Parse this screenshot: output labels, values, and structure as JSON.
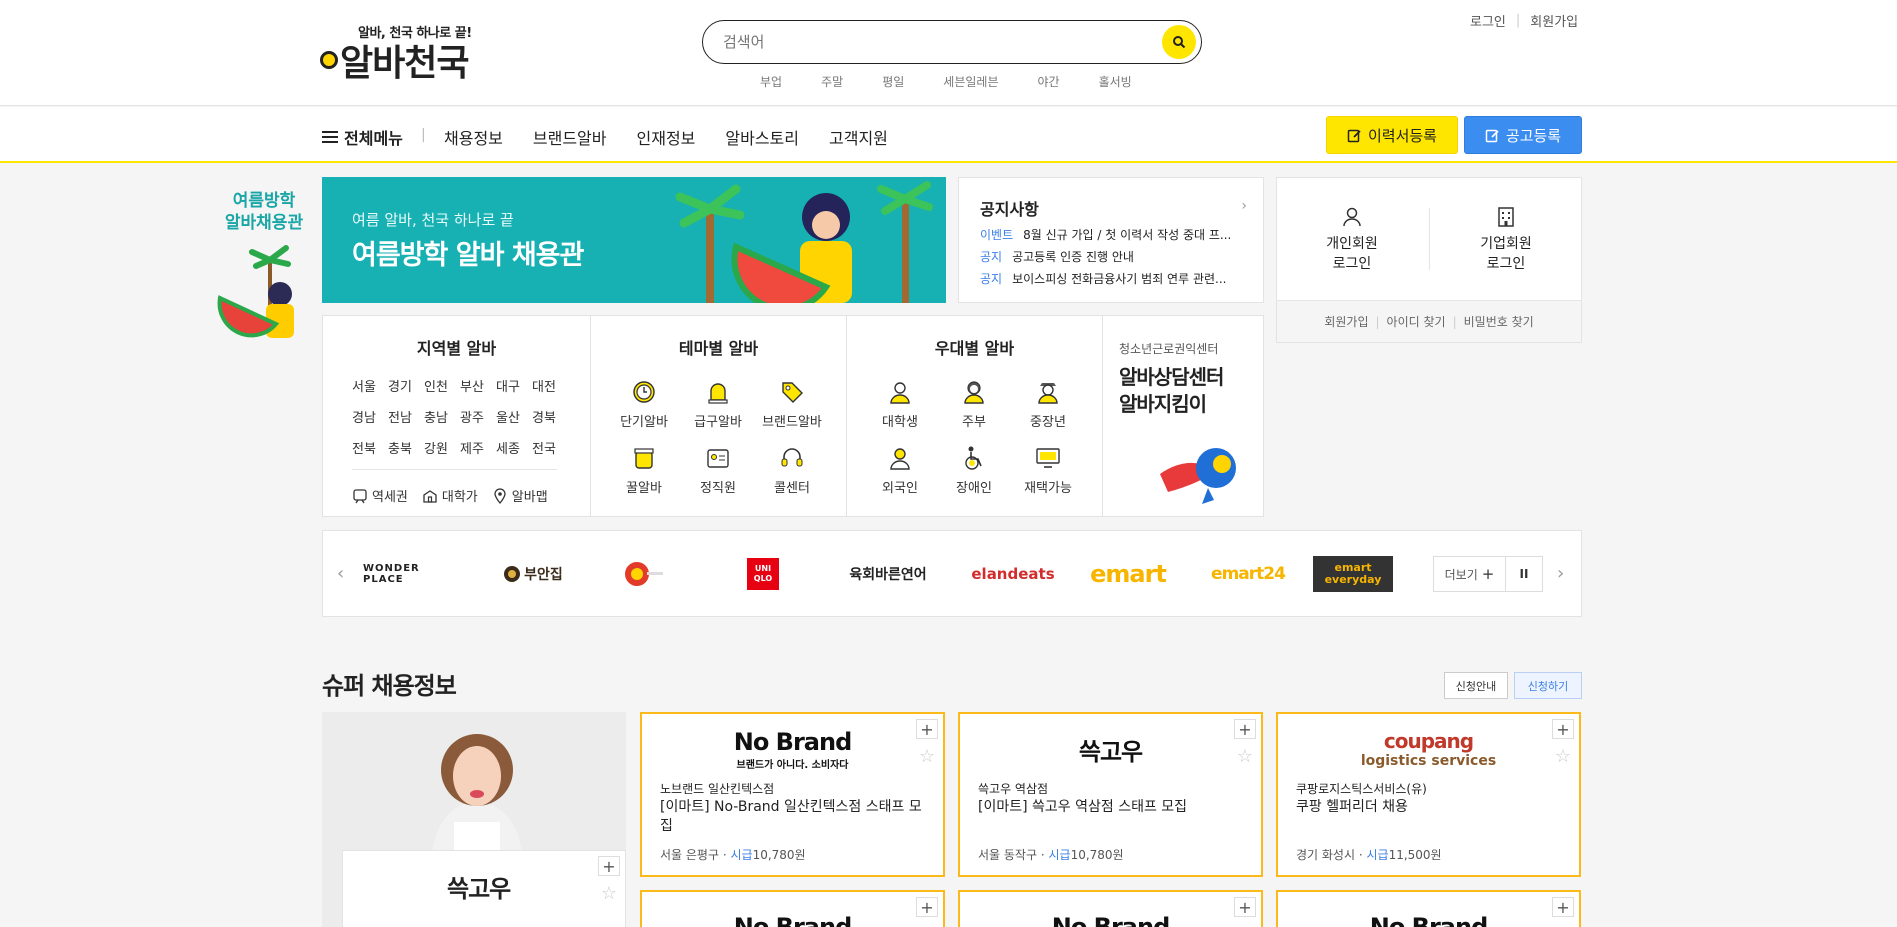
{
  "header": {
    "slogan": "알바, 천국 하나로 끝!",
    "logo_text": "알바천국",
    "search_placeholder": "검색어",
    "keywords": [
      "부업",
      "주말",
      "평일",
      "세븐일레븐",
      "야간",
      "홀서빙"
    ],
    "login": "로그인",
    "signup": "회원가입"
  },
  "gnb": {
    "all_menu": "전체메뉴",
    "items": [
      "채용정보",
      "브랜드알바",
      "인재정보",
      "알바스토리",
      "고객지원"
    ],
    "resume_button": "이력서등록",
    "job_post_button": "공고등록"
  },
  "side_banner": {
    "line1": "여름방학",
    "line2": "알바채용관"
  },
  "main_banner": {
    "sub": "여름 알바, 천국 하나로 끝",
    "title": "여름방학 알바 채용관"
  },
  "notice": {
    "title": "공지사항",
    "items": [
      {
        "tag": "이벤트",
        "text": "8월 신규 가입 / 첫 이력서 작성 중대 프..."
      },
      {
        "tag": "공지",
        "text": "공고등록 인증 진행 안내"
      },
      {
        "tag": "공지",
        "text": "보이스피싱 전화금융사기 범죄 연루 관련..."
      }
    ]
  },
  "login_box": {
    "personal_line1": "개인회원",
    "personal_line2": "로그인",
    "company_line1": "기업회원",
    "company_line2": "로그인",
    "links": [
      "회원가입",
      "아이디 찾기",
      "비밀번호 찾기"
    ]
  },
  "category": {
    "region_title": "지역별 알바",
    "regions": [
      "서울",
      "경기",
      "인천",
      "부산",
      "대구",
      "대전",
      "경남",
      "전남",
      "충남",
      "광주",
      "울산",
      "경북",
      "전북",
      "충북",
      "강원",
      "제주",
      "세종",
      "전국"
    ],
    "region_sub": [
      "역세권",
      "대학가",
      "알바맵"
    ],
    "theme_title": "테마별 알바",
    "themes": [
      "단기알바",
      "급구알바",
      "브랜드알바",
      "꿀알바",
      "정직원",
      "콜센터"
    ],
    "benefit_title": "우대별 알바",
    "benefits": [
      "대학생",
      "주부",
      "중장년",
      "외국인",
      "장애인",
      "재택가능"
    ],
    "counsel_small": "청소년근로권익센터",
    "counsel_line1": "알바상담센터",
    "counsel_line2": "알바지킴이"
  },
  "brands": {
    "items": [
      "WONDER PLACE",
      "부안집",
      "",
      "UNIQLO",
      "육회바른연어",
      "elandeats",
      "emart",
      "emart24",
      "emart everyday"
    ],
    "more": "더보기"
  },
  "super": {
    "title": "슈퍼 채용정보",
    "guide_button": "신청안내",
    "apply_button": "신청하기",
    "ad_logo": "쓱고우",
    "cards": [
      {
        "logo": "No Brand",
        "logo_sub": "브랜드가 아니다. 소비자다",
        "company": "노브랜드 일산킨텍스점",
        "title": "[이마트] No-Brand 일산킨텍스점 스태프 모집",
        "location": "서울 은평구 · ",
        "pay_label": "시급",
        "pay": "10,780원"
      },
      {
        "logo": "쓱고우",
        "logo_sub": "",
        "company": "쓱고우 역삼점",
        "title": "[이마트] 쓱고우 역삼점 스태프 모집",
        "location": "서울 동작구 · ",
        "pay_label": "시급",
        "pay": "10,780원"
      },
      {
        "logo": "coupang",
        "logo_sub": "logistics services",
        "company": "쿠팡로지스틱스서비스(유)",
        "title": "쿠팡 헬퍼리더 채용",
        "location": "경기 화성시 · ",
        "pay_label": "시급",
        "pay": "11,500원"
      },
      {
        "logo": "No Brand",
        "logo_sub": "",
        "company": "",
        "title": "",
        "location": "",
        "pay_label": "",
        "pay": ""
      },
      {
        "logo": "No Brand",
        "logo_sub": "",
        "company": "",
        "title": "",
        "location": "",
        "pay_label": "",
        "pay": ""
      },
      {
        "logo": "No Brand",
        "logo_sub": "",
        "company": "",
        "title": "",
        "location": "",
        "pay_label": "",
        "pay": ""
      }
    ]
  },
  "colors": {
    "accent_yellow": "#ffe600",
    "accent_blue": "#3c8df0",
    "teal_banner": "#17b0b3",
    "card_border": "#fbb91a",
    "link_blue": "#3c7fe6"
  }
}
